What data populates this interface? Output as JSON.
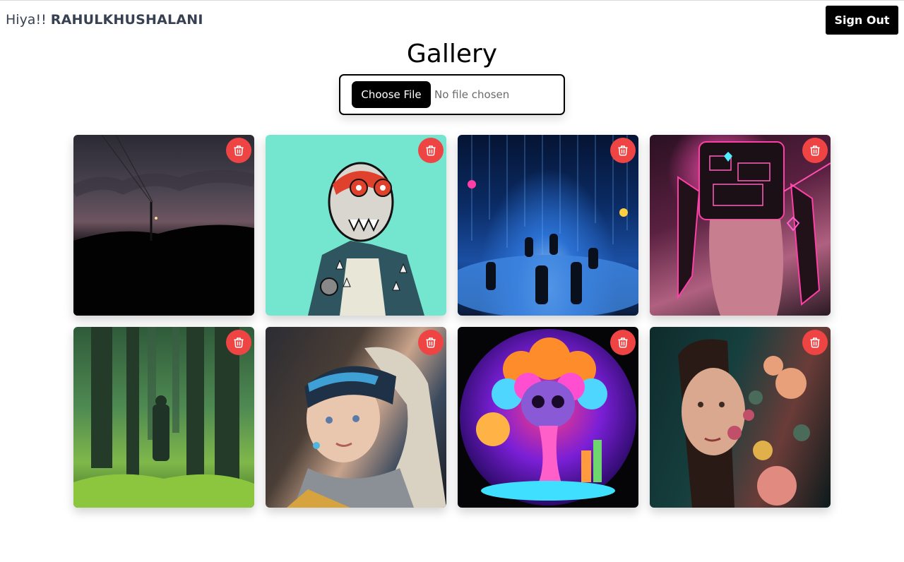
{
  "header": {
    "greeting_prefix": "Hiya!!",
    "username": "RAHULKHUSHALANI",
    "sign_out_label": "Sign Out"
  },
  "page": {
    "title": "Gallery"
  },
  "uploader": {
    "button_label": "Choose File",
    "status_text": "No file chosen"
  },
  "gallery": {
    "delete_icon": "trash-icon",
    "delete_color": "#ef4444",
    "items": [
      {
        "art": "dusk-sky-silhouette-photo"
      },
      {
        "art": "cartoon-skull-ape-spiked-jacket"
      },
      {
        "art": "digital-rain-light-installation"
      },
      {
        "art": "cyberpunk-neon-android-torso"
      },
      {
        "art": "man-in-misty-green-forest"
      },
      {
        "art": "girl-with-pearl-earring-style-portrait"
      },
      {
        "art": "psychedelic-skull-mushroom-cloud"
      },
      {
        "art": "floral-woman-portrait"
      }
    ]
  }
}
